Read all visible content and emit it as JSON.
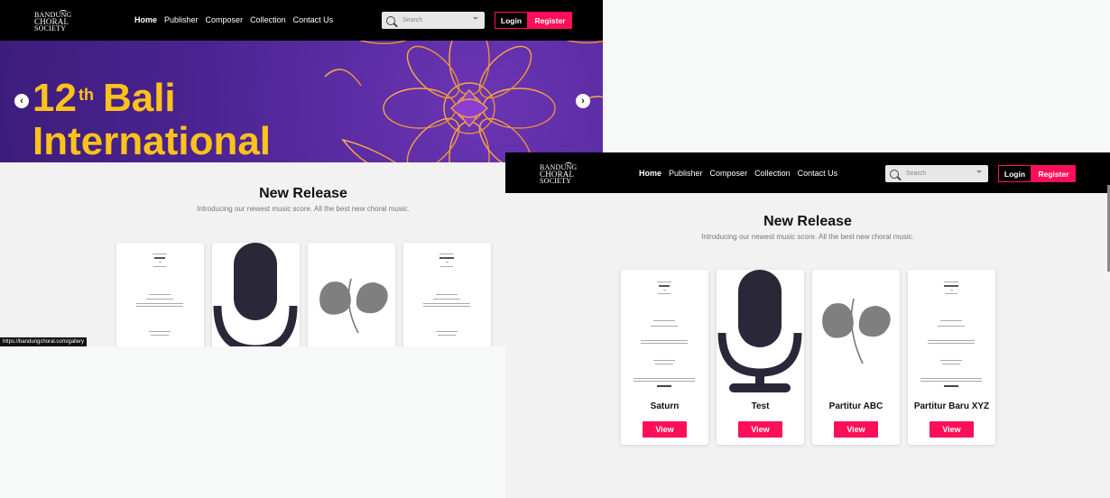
{
  "logo": {
    "line1": "BANDUNG",
    "line2": "CHORAL",
    "line3": "SOCIETY"
  },
  "nav": {
    "items": [
      "Home",
      "Publisher",
      "Composer",
      "Collection",
      "Contact Us"
    ]
  },
  "search": {
    "placeholder": "Search"
  },
  "auth": {
    "login": "Login",
    "register": "Register"
  },
  "banner": {
    "line1_number": "12",
    "line1_sup": "th",
    "line1_word": "Bali",
    "line2": "International"
  },
  "section": {
    "title": "New Release",
    "subtitle": "Introducing our newest music score. All the best new choral music."
  },
  "cards": [
    {
      "title": "Saturn",
      "button": "View"
    },
    {
      "title": "Test",
      "button": "View"
    },
    {
      "title": "Partitur ABC",
      "button": "View"
    },
    {
      "title": "Partitur Baru XYZ",
      "button": "View"
    }
  ],
  "status_url": "https://bandungchoral.com/gallery",
  "colors": {
    "accent": "#ff0f59",
    "banner_text": "#ffc21a",
    "banner_bg": "#4a2390",
    "nav_bg": "#000000"
  }
}
